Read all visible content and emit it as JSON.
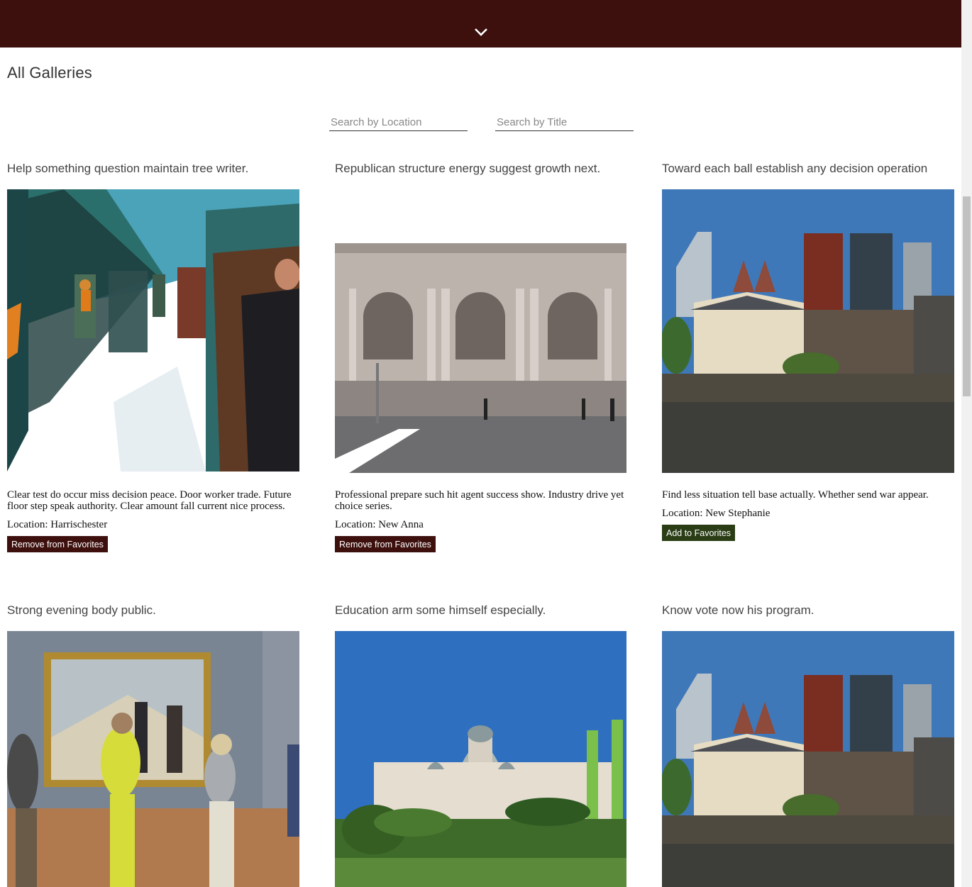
{
  "header": {
    "toggle_icon": "chevron-down-icon",
    "color": "#3d100e"
  },
  "page": {
    "title": "All Galleries"
  },
  "search": {
    "location_placeholder": "Search by Location",
    "title_placeholder": "Search by Title"
  },
  "colors": {
    "remove_button": "#3d100e",
    "add_button": "#2a3d15"
  },
  "galleries": [
    {
      "title": "Help something question maintain tree writer.",
      "description": "Clear test do occur miss decision peace. Door worker trade. Future floor step speak authority. Clear amount fall current nice process.",
      "location": "Location: Harrischester",
      "button": "Remove from Favorites",
      "favorite": true,
      "image": "glass-panels-art-installation"
    },
    {
      "title": "Republican structure energy suggest growth next.",
      "description": "Professional prepare such hit agent success show. Industry drive yet choice series.",
      "location": "Location: New Anna",
      "button": "Remove from Favorites",
      "favorite": true,
      "image": "museum-facade-with-steps"
    },
    {
      "title": "Toward each ball establish any decision operation",
      "description": "Find less situation tell base actually. Whether send war appear.",
      "location": "Location: New Stephanie",
      "button": "Add to Favorites",
      "favorite": false,
      "image": "palace-by-lake-with-skyscrapers"
    },
    {
      "title": "Strong evening body public.",
      "image": "visitors-viewing-painting"
    },
    {
      "title": "Education arm some himself especially.",
      "image": "domed-museum-with-garden"
    },
    {
      "title": "Know vote now his program.",
      "image": "palace-by-lake-with-skyscrapers"
    }
  ]
}
